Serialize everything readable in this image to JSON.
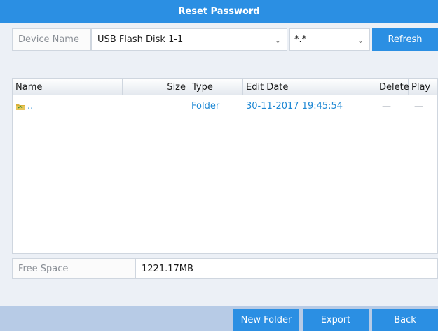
{
  "window": {
    "title": "Reset Password"
  },
  "filter_bar": {
    "device_label": "Device Name",
    "device_value": "USB Flash Disk 1-1",
    "file_filter_value": "*.*",
    "refresh_label": "Refresh"
  },
  "table": {
    "headers": {
      "name": "Name",
      "size": "Size",
      "type": "Type",
      "edit_date": "Edit Date",
      "delete": "Delete",
      "play": "Play"
    },
    "rows": [
      {
        "name": "..",
        "size": "",
        "type": "Folder",
        "edit_date": "30-11-2017 19:45:54",
        "delete": "—",
        "play": "—",
        "icon": "folder-up-icon"
      }
    ]
  },
  "free_space": {
    "label": "Free Space",
    "value": "1221.17MB"
  },
  "buttons": {
    "new_folder": "New Folder",
    "export": "Export",
    "back": "Back"
  },
  "colors": {
    "accent": "#2b8fe3",
    "link": "#1e88d4",
    "footer": "#b7cbe6"
  }
}
